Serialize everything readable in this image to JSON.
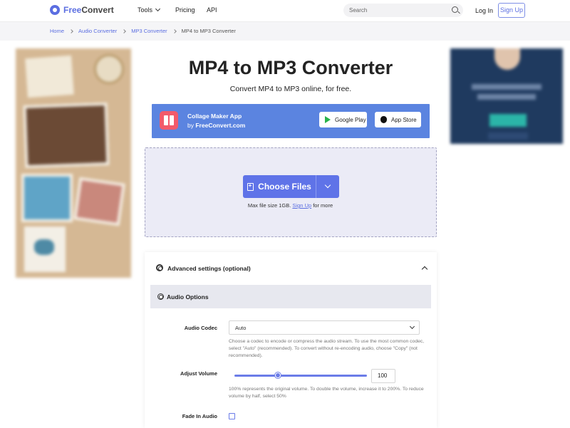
{
  "header": {
    "logo": {
      "part1": "Free",
      "part2": "Convert"
    },
    "nav": {
      "tools": "Tools",
      "pricing": "Pricing",
      "api": "API"
    },
    "search_placeholder": "Search",
    "login": "Log In",
    "signup": "Sign Up"
  },
  "breadcrumb": [
    "Home",
    "Audio Converter",
    "MP3 Converter",
    "MP4 to MP3 Converter"
  ],
  "main": {
    "title": "MP4 to MP3 Converter",
    "subtitle": "Convert MP4 to MP3 online, for free."
  },
  "banner": {
    "app_name": "Collage Maker App",
    "by_prefix": "by",
    "by_brand": "FreeConvert.com",
    "google_play": "Google Play",
    "app_store": "App Store"
  },
  "upload": {
    "choose_files": "Choose Files",
    "max_size_text": "Max file size 1GB.",
    "signup_link": "Sign Up",
    "suffix": "for more"
  },
  "settings": {
    "advanced_title": "Advanced settings (optional)",
    "audio_options": "Audio Options",
    "audio_codec_label": "Audio Codec",
    "audio_codec_value": "Auto",
    "audio_codec_help": "Choose a codec to encode or compress the audio stream. To use the most common codec, select \"Auto\" (recommended). To convert without re-encoding audio, choose \"Copy\" (not recommended).",
    "volume_label": "Adjust Volume",
    "volume_value": "100",
    "volume_level_fraction": 0.33,
    "volume_help": "100% represents the original volume. To double the volume, increase it to 200%. To reduce volume by half, select 50%",
    "fade_in_label": "Fade In Audio",
    "fade_in_checked": false
  },
  "colors": {
    "accent": "#5b6ee1",
    "button": "#5f73e8",
    "banner": "#5b84e0"
  }
}
